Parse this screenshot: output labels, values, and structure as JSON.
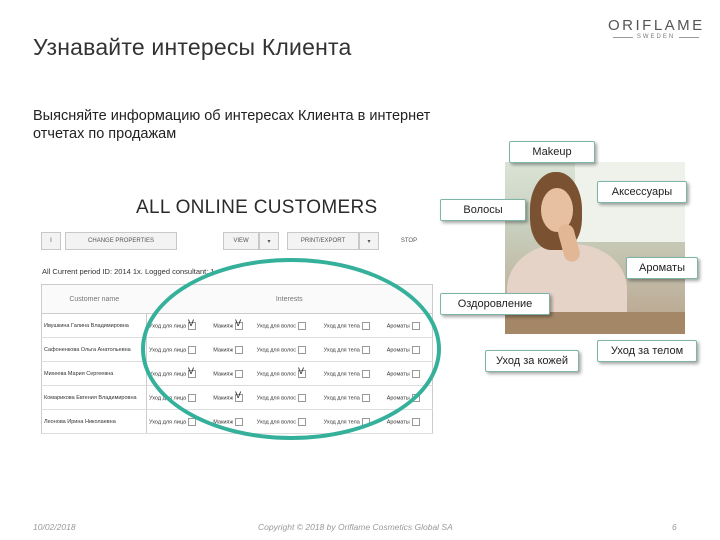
{
  "slide": {
    "title": "Узнавайте интересы Клиента",
    "subtitle": "Выясняйте информацию об интересах Клиента в интернет отчетах по продажам",
    "logo": {
      "brand": "ORIFLAME",
      "sub": "SWEDEN"
    }
  },
  "report": {
    "title": "ALL ONLINE CUSTOMERS",
    "toolbar": [
      "I",
      "CHANGE PROPERTIES",
      "VIEW",
      "▾",
      "PRINT/EXPORT",
      "▾",
      "STOP"
    ],
    "period": "All   Current period ID: 2014 1x. Logged consultant: 1",
    "columns": [
      "Customer name",
      "Interests"
    ],
    "interests": [
      "Уход для лица",
      "Макияж",
      "Уход для волос",
      "Уход для тела",
      "Ароматы"
    ],
    "rows": [
      {
        "name": "Ивушкина Галина Владимировна",
        "checks": [
          true,
          true,
          false,
          false,
          false
        ]
      },
      {
        "name": "Сафоненкова Ольга Анатольевна",
        "checks": [
          false,
          false,
          false,
          false,
          false
        ]
      },
      {
        "name": "Михеева Мария Сергеевна",
        "checks": [
          true,
          false,
          true,
          false,
          false
        ]
      },
      {
        "name": "Комарикова Евгения Владимировна",
        "checks": [
          false,
          true,
          false,
          false,
          false
        ]
      },
      {
        "name": "Леонова Ирина Николаевна",
        "checks": [
          false,
          false,
          false,
          false,
          false
        ]
      }
    ]
  },
  "tags": {
    "makeup": "Makeup",
    "accessories": "Аксессуары",
    "hair": "Волосы",
    "fragrances": "Ароматы",
    "wellness": "Оздоровление",
    "skincare": "Уход за кожей",
    "bodycare": "Уход за телом"
  },
  "footer": {
    "date": "10/02/2018",
    "copyright": "Copyright © 2018 by Oriflame Cosmetics Global SA",
    "page": "6"
  },
  "colors": {
    "highlight_oval": "#35b09a",
    "tag_border": "#7fb4a8"
  }
}
